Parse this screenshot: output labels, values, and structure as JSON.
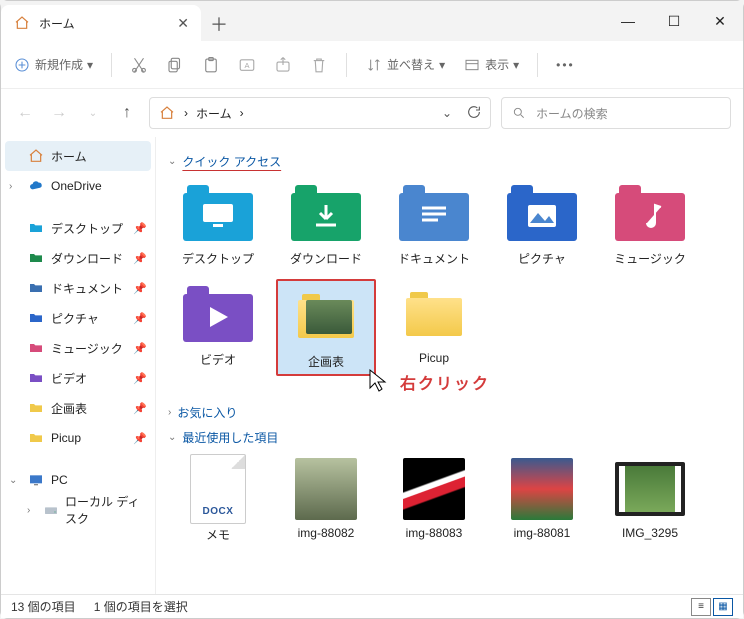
{
  "window": {
    "tab_title": "ホーム"
  },
  "toolbar": {
    "new": "新規作成",
    "sort": "並べ替え",
    "view": "表示"
  },
  "nav": {
    "path_root": "ホーム",
    "path_sep": "›",
    "search_placeholder": "ホームの検索"
  },
  "sidebar": {
    "home": "ホーム",
    "onedrive": "OneDrive",
    "pinned": [
      {
        "label": "デスクトップ",
        "color": "#1aa2d8"
      },
      {
        "label": "ダウンロード",
        "color": "#1e8a4c"
      },
      {
        "label": "ドキュメント",
        "color": "#3a6fb0"
      },
      {
        "label": "ピクチャ",
        "color": "#2b66c9"
      },
      {
        "label": "ミュージック",
        "color": "#d64b7a"
      },
      {
        "label": "ビデオ",
        "color": "#7a4fc4"
      },
      {
        "label": "企画表",
        "color": "#f0c94a"
      },
      {
        "label": "Picup",
        "color": "#f0c94a"
      }
    ],
    "pc": "PC",
    "local_disk": "ローカル ディスク"
  },
  "sections": {
    "quick": "クイック アクセス",
    "fav": "お気に入り",
    "recent": "最近使用した項目"
  },
  "quick_items": [
    {
      "label": "デスクトップ",
      "bg": "#1aa2d8",
      "icon": "monitor"
    },
    {
      "label": "ダウンロード",
      "bg": "#17a36a",
      "icon": "download"
    },
    {
      "label": "ドキュメント",
      "bg": "#4a86cf",
      "icon": "lines"
    },
    {
      "label": "ピクチャ",
      "bg": "#2b66c9",
      "icon": "picture"
    },
    {
      "label": "ミュージック",
      "bg": "#d64b7a",
      "icon": "note"
    },
    {
      "label": "ビデオ",
      "bg": "#7a4fc4",
      "icon": "play"
    },
    {
      "label": "企画表",
      "bg": "#f8d06b",
      "icon": "photo",
      "selected": true
    },
    {
      "label": "Picup",
      "bg": "#f8d06b",
      "icon": "blank"
    }
  ],
  "annotation": {
    "text": "右クリック"
  },
  "recent_items": [
    {
      "label": "メモ",
      "type": "docx",
      "docx_label": "DOCX"
    },
    {
      "label": "img-88082",
      "type": "img",
      "bg": "linear-gradient(#b7c2a0,#5d6a4d)"
    },
    {
      "label": "img-88083",
      "type": "img",
      "bg": "linear-gradient(160deg,#000 40%,#fff 42%,#fff 48%,#d23 49%,#d23 60%,#000 62%)"
    },
    {
      "label": "img-88081",
      "type": "img",
      "bg": "linear-gradient(#3a5a8f,#d44,#2a7a3a)"
    },
    {
      "label": "IMG_3295",
      "type": "film"
    }
  ],
  "status": {
    "count": "13 個の項目",
    "selected": "1 個の項目を選択"
  }
}
